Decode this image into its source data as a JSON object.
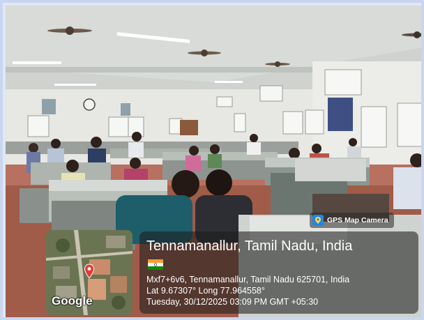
{
  "photo": {
    "subject": "computer lab with students at desktop workstations",
    "colors": {
      "frame": "#c9d6f0",
      "stamp_bg": "#2a2a2a",
      "gps_icon": "#1e88e5"
    }
  },
  "gps_badge": {
    "icon": "gps-map-camera-icon",
    "label": "GPS Map Camera"
  },
  "map_thumbnail": {
    "logo_text": "Google",
    "pin_icon": "map-pin-icon"
  },
  "stamp": {
    "location": "Tennamanallur, Tamil Nadu, India",
    "flag_icon": "india-flag-icon",
    "address": "Mxf7+6v6, Tennamanallur, Tamil Nadu 625701, India",
    "coordinates": "Lat 9.67307° Long 77.964558°",
    "timestamp": "Tuesday, 30/12/2025 03:09 PM GMT +05:30"
  }
}
